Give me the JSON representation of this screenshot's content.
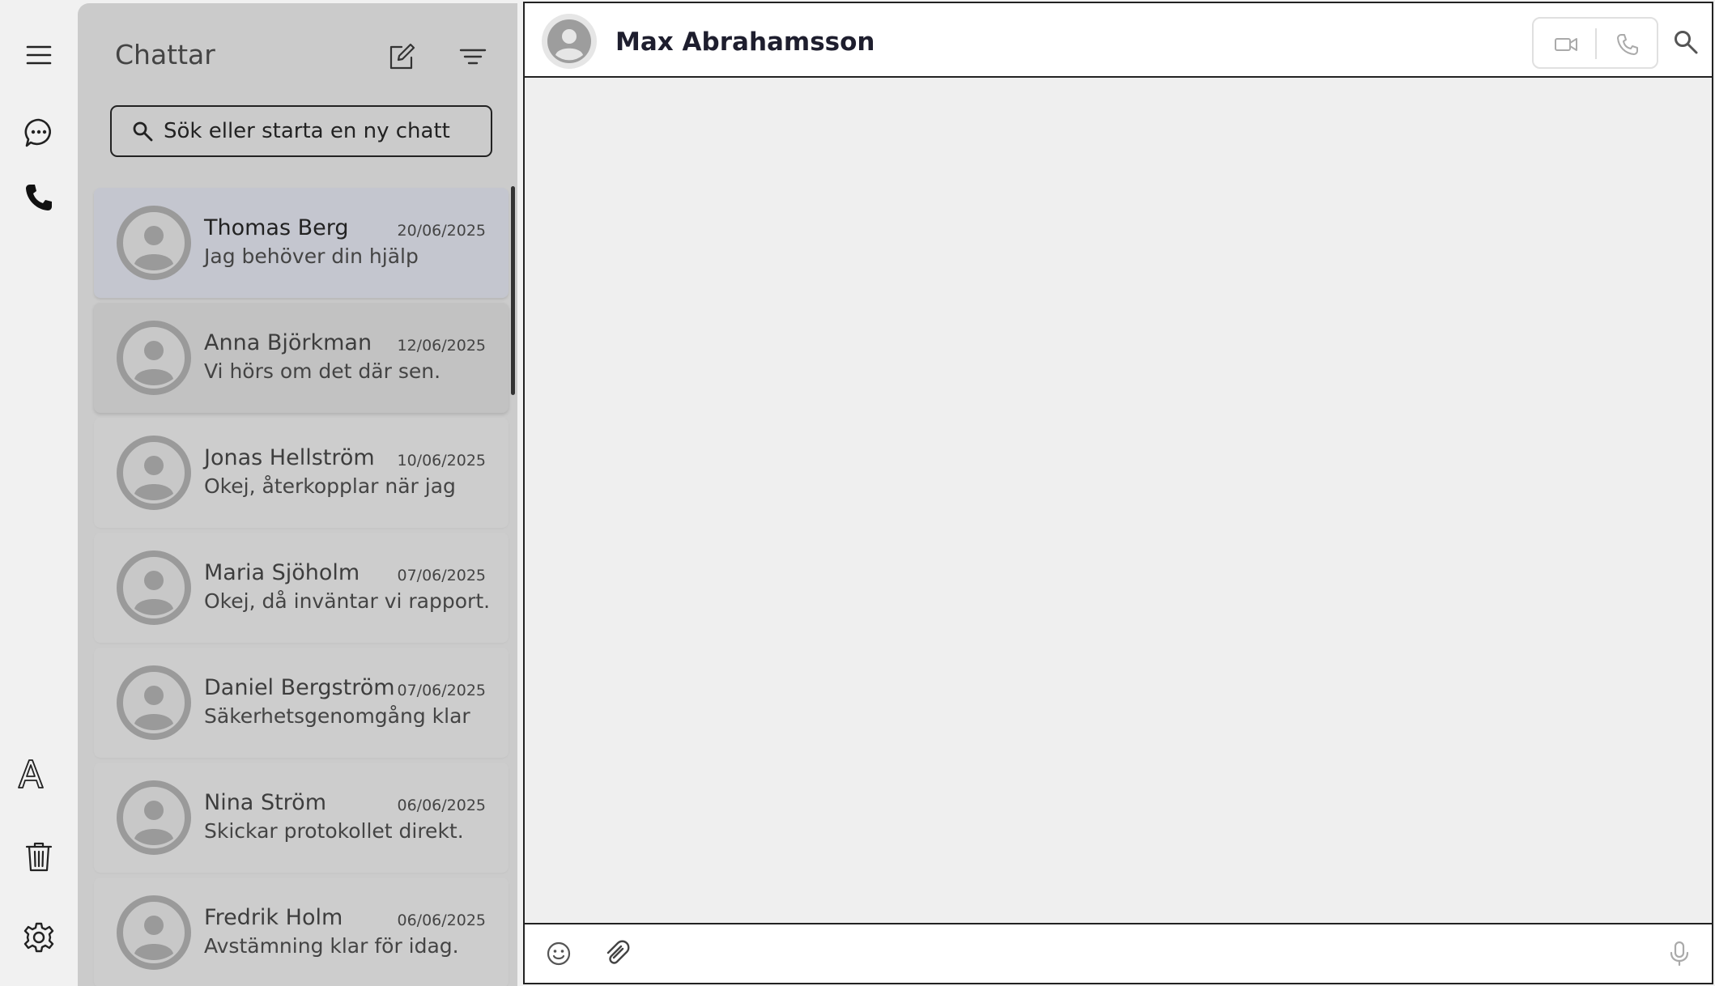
{
  "rail": {
    "icons": [
      "menu-icon",
      "chat-icon",
      "phone-icon",
      "font-icon",
      "trash-icon",
      "settings-icon"
    ]
  },
  "list": {
    "title": "Chattar",
    "search_placeholder": "Sök eller starta en ny chatt",
    "tools": [
      "new-chat-icon",
      "filter-icon"
    ],
    "chats": [
      {
        "name": "Thomas Berg",
        "date": "20/06/2025",
        "preview": "Jag behöver din hjälp"
      },
      {
        "name": "Anna Björkman",
        "date": "12/06/2025",
        "preview": "Vi hörs om det där sen."
      },
      {
        "name": "Jonas Hellström",
        "date": "10/06/2025",
        "preview": "Okej, återkopplar när jag"
      },
      {
        "name": "Maria Sjöholm",
        "date": "07/06/2025",
        "preview": "Okej, då inväntar vi rapport."
      },
      {
        "name": "Daniel Bergström",
        "date": "07/06/2025",
        "preview": "Säkerhetsgenomgång klar"
      },
      {
        "name": "Nina Ström",
        "date": "06/06/2025",
        "preview": "Skickar protokollet direkt."
      },
      {
        "name": "Fredrik Holm",
        "date": "06/06/2025",
        "preview": "Avstämning klar för idag."
      }
    ]
  },
  "conversation": {
    "contact_name": "Max Abrahamsson",
    "message_input": ""
  },
  "colors": {
    "list_bg": "#cbcbcb",
    "selected_item": "#c4c6cf",
    "conversation_bg": "#efefef",
    "rail_bg": "#f1f1f1"
  }
}
